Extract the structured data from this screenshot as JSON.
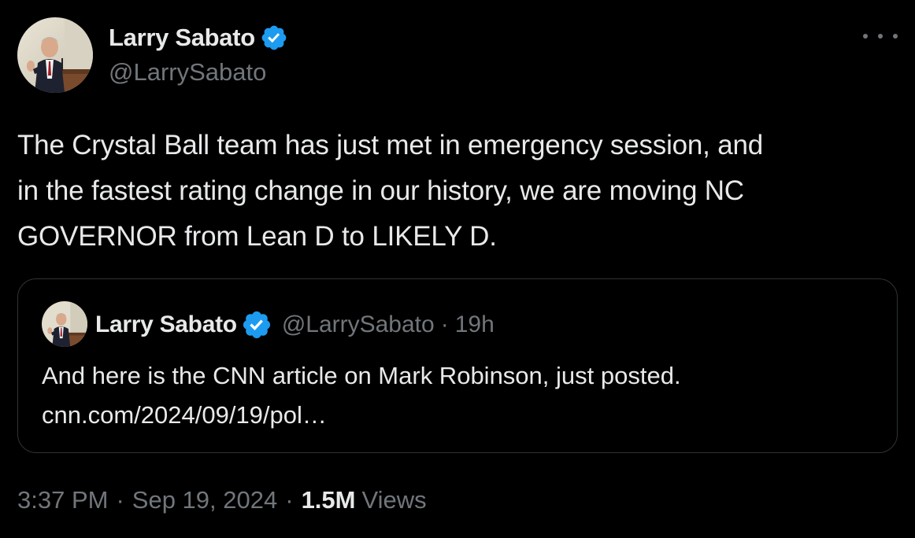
{
  "colors": {
    "background": "#000000",
    "text_primary": "#e7e9ea",
    "text_secondary": "#71767b",
    "verified_blue": "#1d9bf0",
    "border": "#2f3336"
  },
  "author": {
    "display_name": "Larry Sabato",
    "handle": "@LarrySabato",
    "verified_icon": "verified-badge-icon",
    "avatar_icon": "avatar-photo"
  },
  "more_menu_icon": "more-dots-icon",
  "tweet": {
    "lines": [
      "The Crystal Ball team has just met in emergency session, and",
      "in the fastest rating change in our history, we are moving NC",
      "GOVERNOR from Lean D to LIKELY D."
    ]
  },
  "quoted": {
    "display_name": "Larry Sabato",
    "handle": "@LarrySabato",
    "separator": "·",
    "time": "19h",
    "lines": [
      "And here is the CNN article on Mark Robinson, just posted.",
      "cnn.com/2024/09/19/pol…"
    ]
  },
  "meta": {
    "time": "3:37 PM",
    "separator": "·",
    "date": "Sep 19, 2024",
    "views_count": "1.5M",
    "views_label": "Views"
  }
}
